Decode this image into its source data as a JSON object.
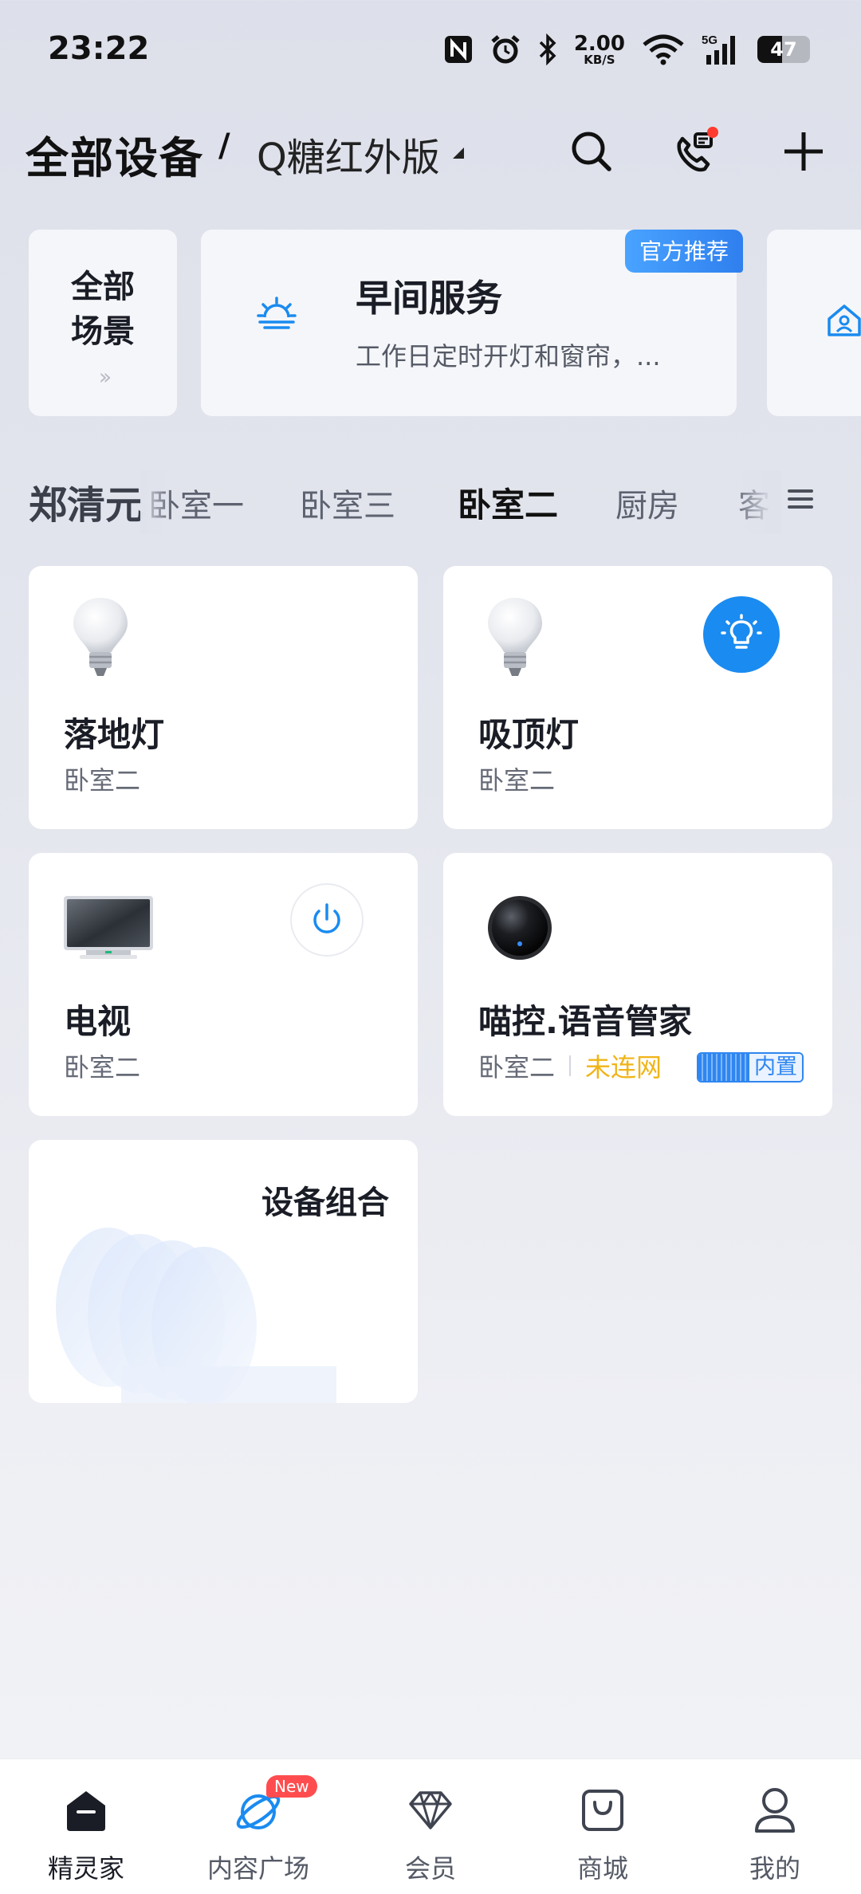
{
  "status_bar": {
    "time": "23:22",
    "net_speed": "2.00",
    "net_unit": "KB/S",
    "battery_percent": "47",
    "battery_level": 0.47,
    "icons": [
      "nfc-icon",
      "alarm-icon",
      "bluetooth-icon",
      "wifi-icon",
      "signal-5g-icon",
      "battery-icon"
    ],
    "signal_label": "5G"
  },
  "header": {
    "title": "全部设备",
    "separator": "/",
    "home_name": "Q糖红外版",
    "icons": [
      "search-icon",
      "call-icon",
      "add-icon"
    ]
  },
  "scenes": {
    "all_line1": "全部",
    "all_line2": "场景",
    "all_arrows": "››",
    "featured": {
      "title": "早间服务",
      "description": "工作日定时开灯和窗帘，...",
      "badge": "官方推荐"
    }
  },
  "rooms": {
    "user": "郑清元",
    "tabs": [
      "卧室一",
      "卧室三",
      "卧室二",
      "厨房",
      "客"
    ],
    "active_index": 2
  },
  "devices": [
    {
      "name": "落地灯",
      "room": "卧室二"
    },
    {
      "name": "吸顶灯",
      "room": "卧室二"
    },
    {
      "name": "电视",
      "room": "卧室二"
    },
    {
      "name": "喵控.语音管家",
      "room": "卧室二",
      "status": "未连网",
      "tag": "内置"
    }
  ],
  "combo": {
    "title": "设备组合"
  },
  "nav": {
    "items": [
      "精灵家",
      "内容广场",
      "会员",
      "商城",
      "我的"
    ],
    "active_index": 0,
    "new_badge": "New"
  },
  "colors": {
    "accent": "#1a8bf0",
    "offline": "#f0b417",
    "badge_red": "#ff4d4f"
  }
}
